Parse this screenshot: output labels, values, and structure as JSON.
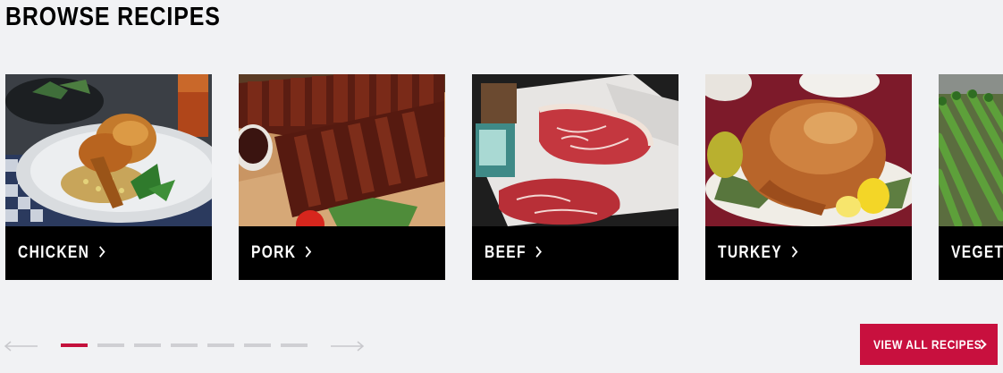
{
  "section": {
    "title": "BROWSE RECIPES"
  },
  "categories": [
    {
      "label": "CHICKEN",
      "icon": "chevron-right-icon",
      "image": "roast chicken on plate"
    },
    {
      "label": "PORK",
      "icon": "chevron-right-icon",
      "image": "glazed pork ribs on board"
    },
    {
      "label": "BEEF",
      "icon": "chevron-right-icon",
      "image": "raw marbled steaks"
    },
    {
      "label": "TURKEY",
      "icon": "chevron-right-icon",
      "image": "whole roast turkey"
    },
    {
      "label": "VEGETA",
      "icon": "chevron-right-icon",
      "image": "asparagus"
    }
  ],
  "pager": {
    "prev_icon": "arrow-left-icon",
    "next_icon": "arrow-right-icon",
    "page_count": 7,
    "active_page": 1
  },
  "cta": {
    "label": "VIEW ALL RECIPES",
    "icon": "chevron-right-icon"
  },
  "colors": {
    "background": "#f1f2f4",
    "card_label_bg": "#000000",
    "accent": "#c8103e",
    "dot_inactive": "#cfcfd3"
  }
}
